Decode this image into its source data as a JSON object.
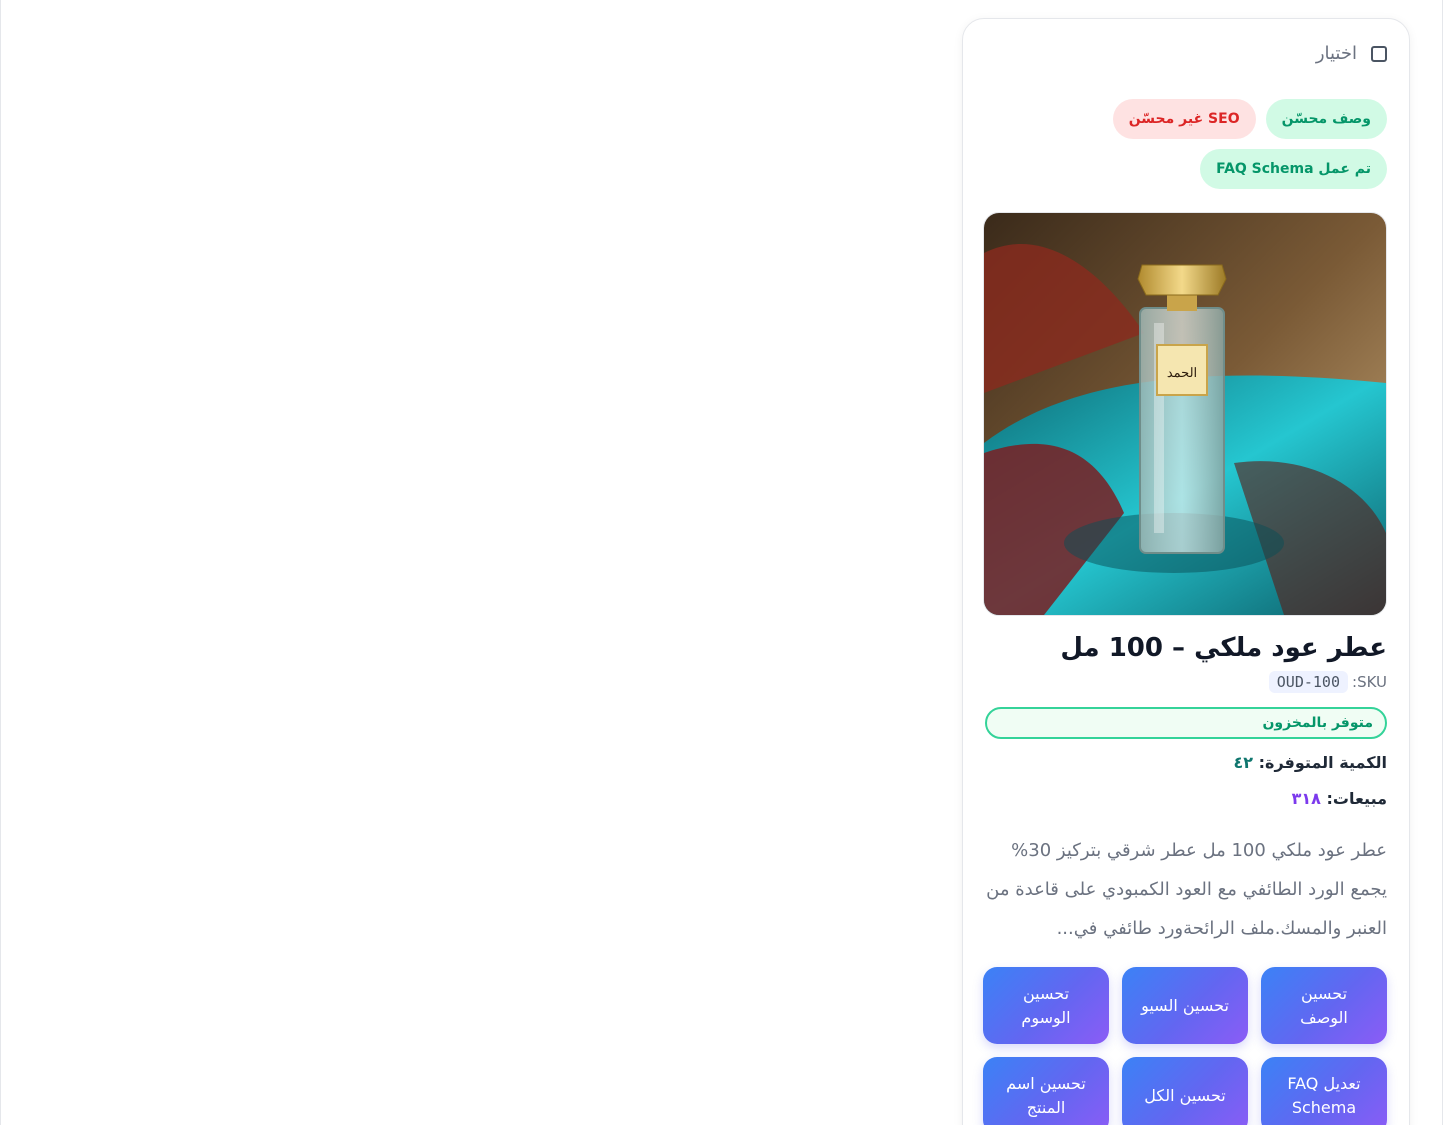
{
  "selection": {
    "label": "اختيار",
    "checked": false
  },
  "badges": [
    {
      "text": "وصف محسّن",
      "status": "success"
    },
    {
      "text": "SEO غير محسّن",
      "status": "danger"
    },
    {
      "text": "تم عمل FAQ Schema",
      "status": "success"
    }
  ],
  "product": {
    "image_icon": "perfume-bottle-photo",
    "image_label_text": "الحمد",
    "title": "عطر عود ملكي – 100 مل",
    "sku_label": "SKU:",
    "sku": "OUD-100",
    "stock_status": "متوفر بالمخزون",
    "quantity_label": "الكمية المتوفرة:",
    "quantity_value": "٤٢",
    "sales_label": "مبيعات:",
    "sales_value": "٣١٨",
    "description": "عطر عود ملكي 100 مل عطر شرقي بتركيز 30% يجمع الورد الطائفي مع العود الكمبودي على قاعدة من العنبر والمسك.ملف الرائحةورد طائفي في..."
  },
  "actions": [
    "تحسين الوصف",
    "تحسين السيو",
    "تحسين الوسوم",
    "تعديل FAQ Schema",
    "تحسين الكل",
    "تحسين اسم المنتج"
  ],
  "colors": {
    "success_bg": "#d1fae5",
    "success_text": "#059669",
    "danger_bg": "#fee2e2",
    "danger_text": "#dc2626",
    "button_gradient_start": "#3b82f6",
    "button_gradient_end": "#8b5cf6",
    "quantity_value": "#0f766e",
    "sales_value": "#7c3aed"
  }
}
